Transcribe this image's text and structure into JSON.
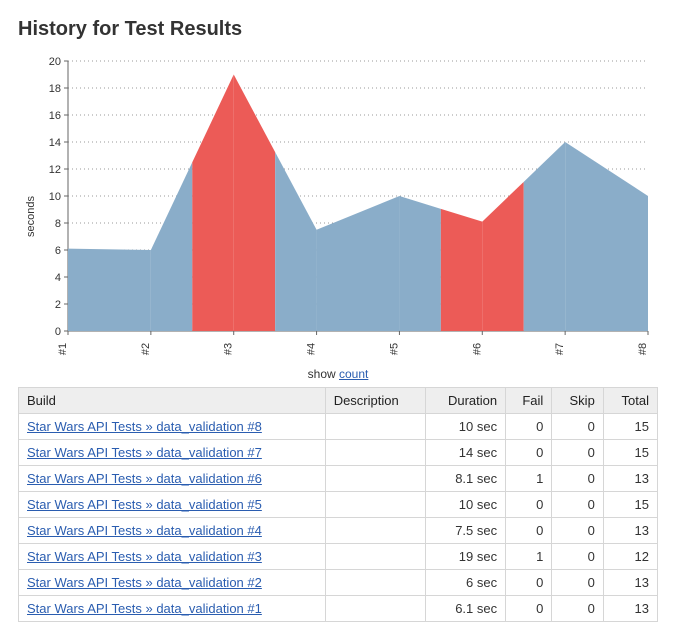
{
  "page": {
    "title": "History for Test Results",
    "show_label_prefix": "show ",
    "show_link_label": "count",
    "ylabel": "seconds"
  },
  "colors": {
    "pass": "#8aadc9",
    "fail": "#ec5b57"
  },
  "chart_data": {
    "type": "area",
    "title": "History for Test Results",
    "xlabel": "",
    "ylabel": "seconds",
    "ylim": [
      0,
      20
    ],
    "yticks": [
      0,
      2,
      4,
      6,
      8,
      10,
      12,
      14,
      16,
      18,
      20
    ],
    "categories": [
      "#1",
      "#2",
      "#3",
      "#4",
      "#5",
      "#6",
      "#7",
      "#8"
    ],
    "values": [
      6.1,
      6,
      19,
      7.5,
      10,
      8.1,
      14,
      10
    ],
    "status": [
      "pass",
      "pass",
      "fail",
      "pass",
      "pass",
      "fail",
      "pass",
      "pass"
    ]
  },
  "table": {
    "columns": [
      "Build",
      "Description",
      "Duration",
      "Fail",
      "Skip",
      "Total"
    ],
    "rows": [
      {
        "build": "Star Wars API Tests » data_validation #8",
        "description": "",
        "duration": "10 sec",
        "fail": 0,
        "skip": 0,
        "total": 15
      },
      {
        "build": "Star Wars API Tests » data_validation #7",
        "description": "",
        "duration": "14 sec",
        "fail": 0,
        "skip": 0,
        "total": 15
      },
      {
        "build": "Star Wars API Tests » data_validation #6",
        "description": "",
        "duration": "8.1 sec",
        "fail": 1,
        "skip": 0,
        "total": 13
      },
      {
        "build": "Star Wars API Tests » data_validation #5",
        "description": "",
        "duration": "10 sec",
        "fail": 0,
        "skip": 0,
        "total": 15
      },
      {
        "build": "Star Wars API Tests » data_validation #4",
        "description": "",
        "duration": "7.5 sec",
        "fail": 0,
        "skip": 0,
        "total": 13
      },
      {
        "build": "Star Wars API Tests » data_validation #3",
        "description": "",
        "duration": "19 sec",
        "fail": 1,
        "skip": 0,
        "total": 12
      },
      {
        "build": "Star Wars API Tests » data_validation #2",
        "description": "",
        "duration": "6 sec",
        "fail": 0,
        "skip": 0,
        "total": 13
      },
      {
        "build": "Star Wars API Tests » data_validation #1",
        "description": "",
        "duration": "6.1 sec",
        "fail": 0,
        "skip": 0,
        "total": 13
      }
    ]
  }
}
